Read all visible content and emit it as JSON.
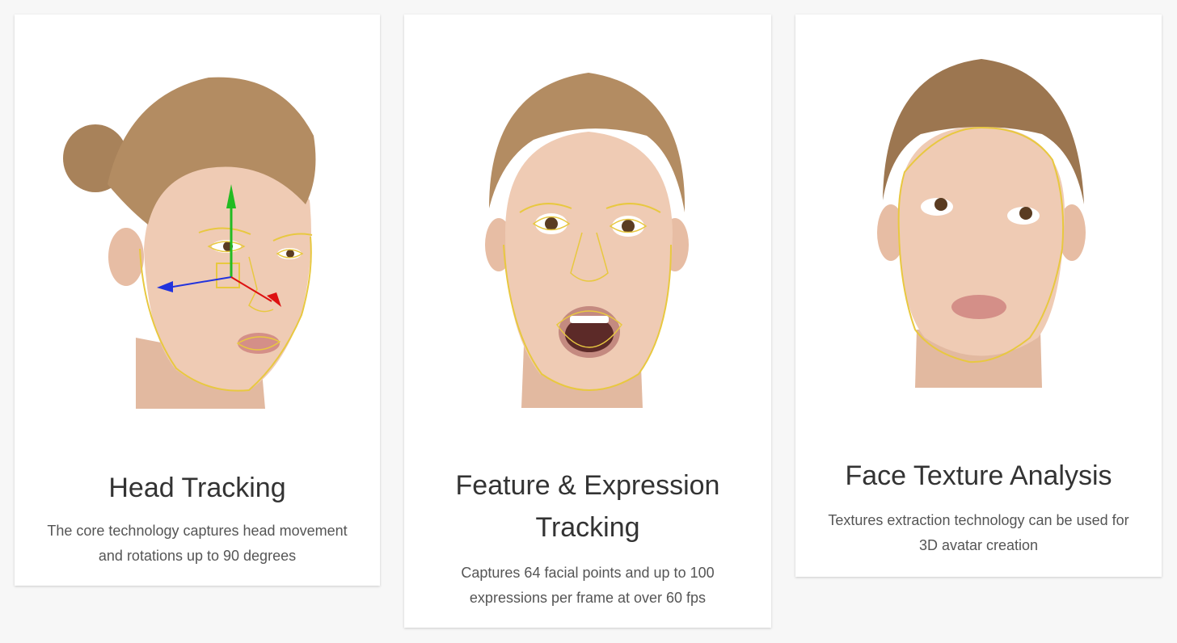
{
  "cards": [
    {
      "title": "Head Tracking",
      "description": "The core technology captures head movement and rotations up to 90 degrees",
      "image_icon": "face-head-tracking-image"
    },
    {
      "title": "Feature & Expression Tracking",
      "description": "Captures 64 facial points and up to 100 expressions per frame at over 60 fps",
      "image_icon": "face-expression-tracking-image"
    },
    {
      "title": "Face Texture Analysis",
      "description": "Textures extraction technology can be used for 3D avatar creation",
      "image_icon": "face-texture-analysis-image"
    }
  ],
  "colors": {
    "background": "#f7f7f7",
    "card": "#ffffff",
    "title": "#333333",
    "description": "#555555",
    "tracking_outline": "#e8c840",
    "axis_y": "#22bb22",
    "axis_x": "#2233dd",
    "axis_z": "#dd1111"
  }
}
